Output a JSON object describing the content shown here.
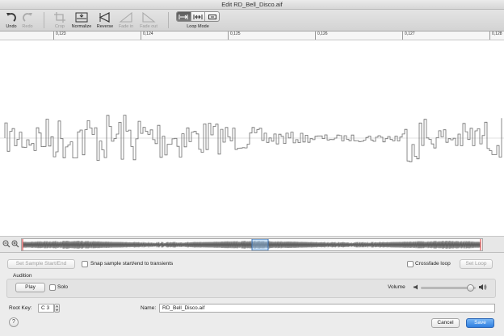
{
  "window": {
    "title": "Edit RD_Bell_Disco.aif"
  },
  "toolbar": {
    "undo": "Undo",
    "redo": "Redo",
    "crop": "Crop",
    "normalize": "Normalize",
    "reverse": "Reverse",
    "fade_in": "Fade in",
    "fade_out": "Fade out",
    "loop_mode": "Loop Mode"
  },
  "ruler": {
    "ticks": [
      "0,123",
      "0,124",
      "0,125",
      "0,126",
      "0,127",
      "0,128"
    ]
  },
  "overview": {
    "loop_start_fraction": 0.5,
    "loop_end_fraction": 0.535
  },
  "sample": {
    "set_start_end": "Set Sample Start/End",
    "snap_label": "Snap sample start/end to transients",
    "snap_checked": false,
    "crossfade_label": "Crossfade loop",
    "crossfade_checked": false,
    "set_loop": "Set Loop"
  },
  "audition": {
    "title": "Audition",
    "play": "Play",
    "solo_label": "Solo",
    "solo_checked": false,
    "volume_label": "Volume",
    "volume_level": 0.9
  },
  "footer": {
    "root_key_label": "Root Key:",
    "root_key_value": "C 3",
    "name_label": "Name:",
    "name_value": "RD_Bell_Disco.aif",
    "help": "?",
    "cancel": "Cancel",
    "save": "Save"
  }
}
